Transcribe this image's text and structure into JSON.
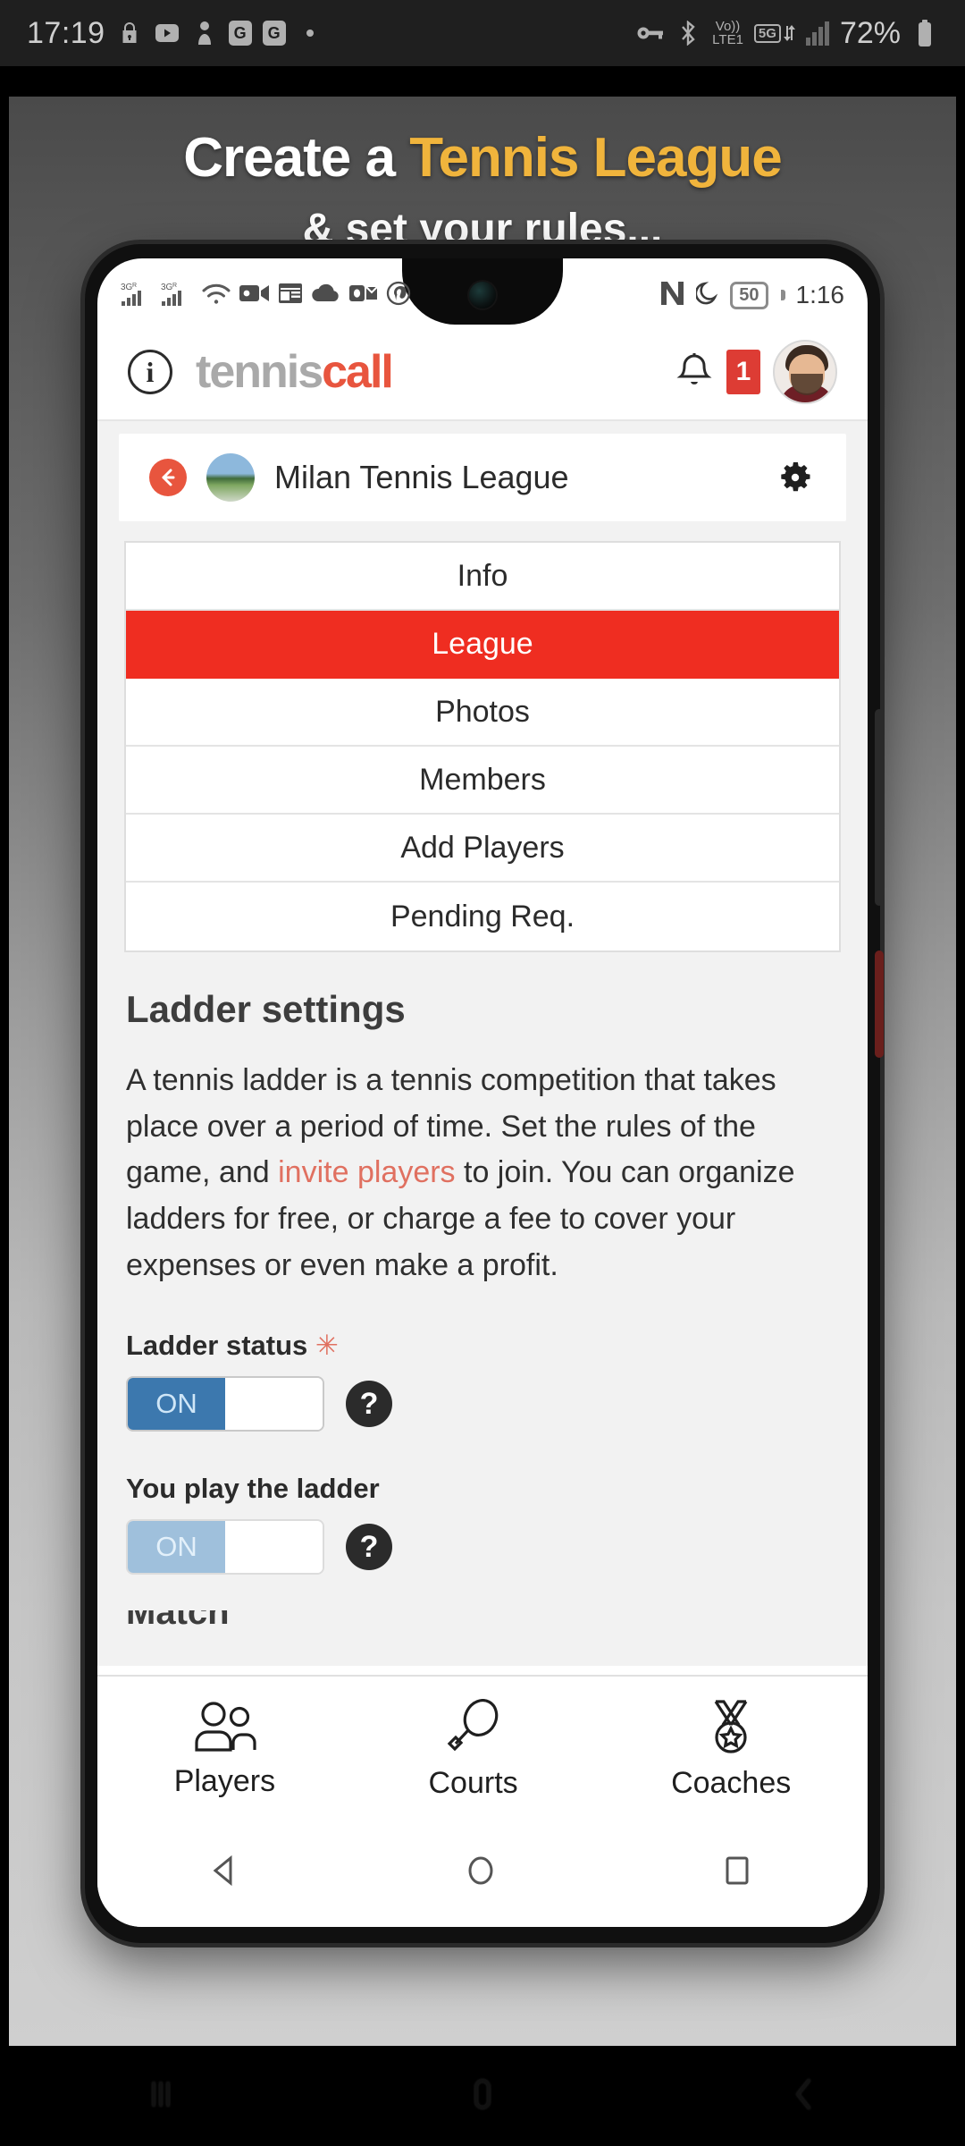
{
  "os_status": {
    "clock": "17:19",
    "left_icons": [
      "lock-icon",
      "youtube-icon",
      "person-icon",
      "google-icon",
      "google-icon",
      "dot-icon"
    ],
    "right_icons": [
      "vpn-key-icon",
      "bluetooth-icon",
      "volte-icon",
      "5g-icon",
      "signal-icon"
    ],
    "volte_top": "Vo))",
    "volte_bottom": "LTE1",
    "network": "5G",
    "battery": "72%"
  },
  "promo": {
    "line1_white": "Create a ",
    "line1_highlight": "Tennis League",
    "line2": "& set your rules...",
    "highlight_color": "#f0b43c"
  },
  "phone_status": {
    "left_icons": [
      "3g-signal-icon",
      "3g-signal-icon",
      "wifi-icon",
      "video-camera-icon",
      "news-icon",
      "cloud-icon",
      "outlook-icon",
      "pinterest-icon"
    ],
    "network_label": "3G",
    "roaming_label": "R",
    "right_icons": [
      "nfc-icon",
      "do-not-disturb-moon-icon"
    ],
    "battery": "50",
    "time": "1:16"
  },
  "app_header": {
    "info_glyph": "i",
    "logo_part1": "tennis",
    "logo_part2": "call",
    "logo_color1": "#a9a9a9",
    "logo_color2": "#e8553e",
    "notification_count": "1",
    "badge_color": "#dd3c34",
    "avatar_name": "user-avatar"
  },
  "league_bar": {
    "back_label": "back-arrow-icon",
    "title": "Milan Tennis League",
    "settings_label": "gear-icon"
  },
  "tabs": [
    {
      "label": "Info",
      "active": false
    },
    {
      "label": "League",
      "active": true
    },
    {
      "label": "Photos",
      "active": false
    },
    {
      "label": "Members",
      "active": false
    },
    {
      "label": "Add Players",
      "active": false
    },
    {
      "label": "Pending Req.",
      "active": false
    }
  ],
  "active_tab_color": "#ef2d21",
  "settings": {
    "title": "Ladder settings",
    "paragraph_1": "A tennis ladder is a tennis competition that takes place over a period of time. Set the rules of the game, and ",
    "paragraph_link": "invite players",
    "paragraph_2": " to join. You can organize ladders for free, or charge a fee to cover your expenses or even make a profit.",
    "ladder_status_label": "Ladder status",
    "required_marker": "✳",
    "ladder_status_value": "ON",
    "you_play_label": "You play the ladder",
    "you_play_value": "ON",
    "help_glyph": "?",
    "next_section_partial": "Match"
  },
  "bottom_nav": [
    {
      "label": "Players",
      "icon": "people-icon"
    },
    {
      "label": "Courts",
      "icon": "tennis-racket-icon"
    },
    {
      "label": "Coaches",
      "icon": "medal-icon"
    }
  ],
  "android_nav": [
    "back-triangle-icon",
    "home-circle-icon",
    "recents-square-icon"
  ],
  "os_nav": [
    "recents-bars-icon",
    "home-pill-icon",
    "back-chevron-icon"
  ]
}
